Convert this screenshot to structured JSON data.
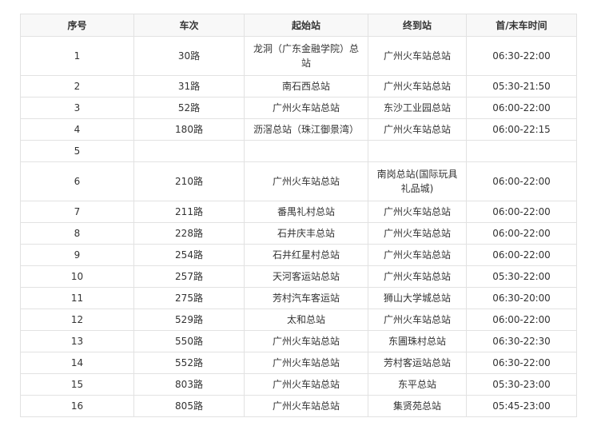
{
  "headers": [
    "序号",
    "车次",
    "起始站",
    "终到站",
    "首/末车时间"
  ],
  "rows": [
    {
      "no": "1",
      "route": "30路",
      "from": "龙洞（广东金融学院）总站",
      "to": "广州火车站总站",
      "time": "06:30-22:00"
    },
    {
      "no": "2",
      "route": "31路",
      "from": "南石西总站",
      "to": "广州火车站总站",
      "time": "05:30-21:50"
    },
    {
      "no": "3",
      "route": "52路",
      "from": "广州火车站总站",
      "to": "东沙工业园总站",
      "time": "06:00-22:00"
    },
    {
      "no": "4",
      "route": "180路",
      "from": "沥滘总站（珠江御景湾）",
      "to": "广州火车站总站",
      "time": "06:00-22:15"
    },
    {
      "no": "5",
      "route": "",
      "from": "",
      "to": "",
      "time": ""
    },
    {
      "no": "6",
      "route": "210路",
      "from": "广州火车站总站",
      "to": "南岗总站(国际玩具礼品城)",
      "time": "06:00-22:00"
    },
    {
      "no": "7",
      "route": "211路",
      "from": "番禺礼村总站",
      "to": "广州火车站总站",
      "time": "06:00-22:00"
    },
    {
      "no": "8",
      "route": "228路",
      "from": "石井庆丰总站",
      "to": "广州火车站总站",
      "time": "06:00-22:00"
    },
    {
      "no": "9",
      "route": "254路",
      "from": "石井红星村总站",
      "to": "广州火车站总站",
      "time": "06:00-22:00"
    },
    {
      "no": "10",
      "route": "257路",
      "from": "天河客运站总站",
      "to": "广州火车站总站",
      "time": "05:30-22:00"
    },
    {
      "no": "11",
      "route": "275路",
      "from": "芳村汽车客运站",
      "to": "狮山大学城总站",
      "time": "06:30-20:00"
    },
    {
      "no": "12",
      "route": "529路",
      "from": "太和总站",
      "to": "广州火车站总站",
      "time": "06:00-22:00"
    },
    {
      "no": "13",
      "route": "550路",
      "from": "广州火车站总站",
      "to": "东圃珠村总站",
      "time": "06:30-22:30"
    },
    {
      "no": "14",
      "route": "552路",
      "from": "广州火车站总站",
      "to": "芳村客运站总站",
      "time": "06:30-22:00"
    },
    {
      "no": "15",
      "route": "803路",
      "from": "广州火车站总站",
      "to": "东平总站",
      "time": "05:30-23:00"
    },
    {
      "no": "16",
      "route": "805路",
      "from": "广州火车站总站",
      "to": "集贤苑总站",
      "time": "05:45-23:00"
    }
  ]
}
